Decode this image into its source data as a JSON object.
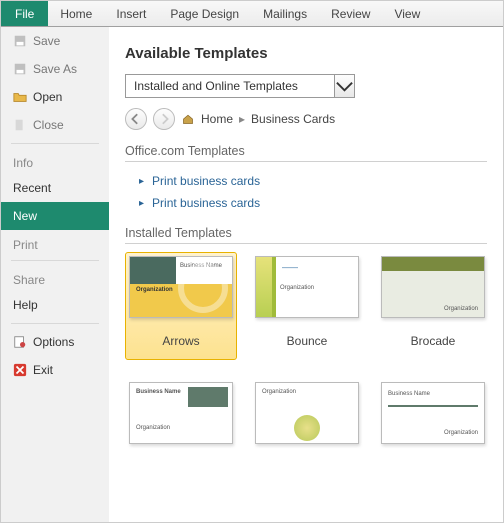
{
  "ribbon": {
    "file": "File",
    "tabs": [
      "Home",
      "Insert",
      "Page Design",
      "Mailings",
      "Review",
      "View"
    ]
  },
  "sidebar": {
    "save": "Save",
    "saveas": "Save As",
    "open": "Open",
    "close": "Close",
    "info": "Info",
    "recent": "Recent",
    "new": "New",
    "print": "Print",
    "share": "Share",
    "help": "Help",
    "options": "Options",
    "exit": "Exit"
  },
  "content": {
    "title": "Available Templates",
    "dropdown": "Installed and Online Templates",
    "breadcrumb": {
      "home": "Home",
      "current": "Business Cards"
    },
    "officecom_head": "Office.com Templates",
    "officecom_links": [
      "Print business cards",
      "Print business cards"
    ],
    "installed_head": "Installed Templates",
    "row1": [
      {
        "name": "Arrows",
        "selected": true,
        "thumbcls": "arrows"
      },
      {
        "name": "Bounce",
        "selected": false,
        "thumbcls": "bounce"
      },
      {
        "name": "Brocade",
        "selected": false,
        "thumbcls": "brocade"
      }
    ],
    "row2": [
      {
        "name": "",
        "thumbcls": "t4"
      },
      {
        "name": "",
        "thumbcls": "t5"
      },
      {
        "name": "",
        "thumbcls": "t6"
      }
    ]
  }
}
